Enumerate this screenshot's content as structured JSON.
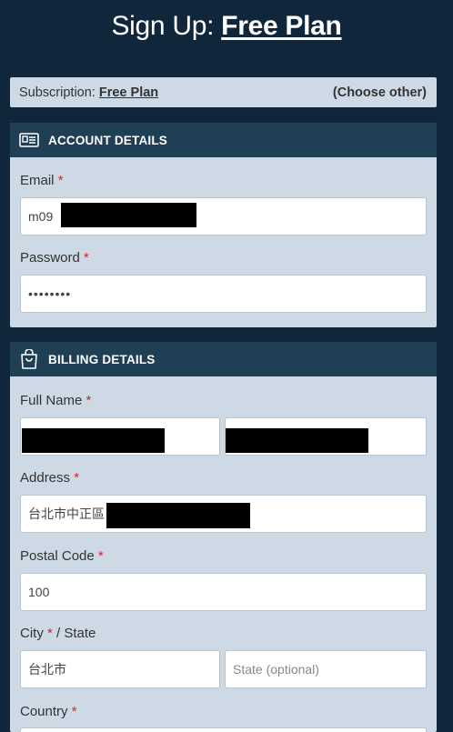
{
  "header": {
    "title_prefix": "Sign Up: ",
    "title_plan": "Free Plan"
  },
  "subscription": {
    "label": "Subscription: ",
    "plan": "Free Plan",
    "choose_other": "(Choose other)"
  },
  "account": {
    "title": "ACCOUNT DETAILS",
    "email_label": "Email",
    "email_value": "m09",
    "password_label": "Password",
    "password_value": "••••••••"
  },
  "billing": {
    "title": "BILLING DETAILS",
    "full_name_label": "Full Name",
    "address_label": "Address",
    "address_value": "台北市中正區",
    "postal_label": "Postal Code",
    "postal_value": "100",
    "city_label": "City",
    "state_label_suffix": " / State",
    "city_value": "台北市",
    "state_placeholder": "State (optional)",
    "country_label": "Country"
  },
  "required_mark": "*"
}
